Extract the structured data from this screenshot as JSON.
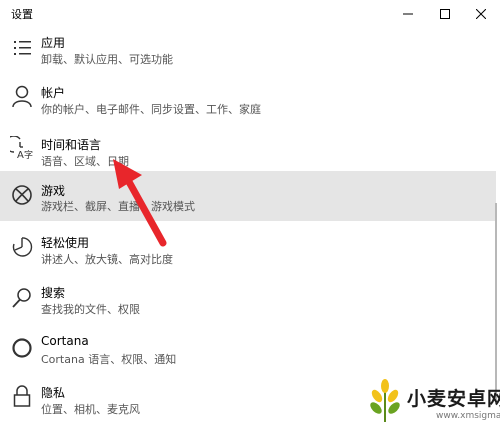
{
  "window": {
    "title": "设置",
    "minimize_label": "—",
    "maximize_label": "☐",
    "close_label": "✕"
  },
  "items": [
    {
      "name": "应用",
      "desc": "卸载、默认应用、可选功能",
      "icon": "apps-list-icon"
    },
    {
      "name": "帐户",
      "desc": "你的帐户、电子邮件、同步设置、工作、家庭",
      "icon": "person-icon"
    },
    {
      "name": "时间和语言",
      "desc": "语音、区域、日期",
      "icon": "time-language-icon"
    },
    {
      "name": "游戏",
      "desc": "游戏栏、截屏、直播、游戏模式",
      "icon": "xbox-icon",
      "selected": true
    },
    {
      "name": "轻松使用",
      "desc": "讲述人、放大镜、高对比度",
      "icon": "ease-of-access-icon"
    },
    {
      "name": "搜索",
      "desc": "查找我的文件、权限",
      "icon": "search-icon"
    },
    {
      "name": "Cortana",
      "desc": "Cortana 语言、权限、通知",
      "icon": "cortana-ring-icon"
    },
    {
      "name": "隐私",
      "desc": "位置、相机、麦克风",
      "icon": "lock-icon"
    }
  ],
  "colors": {
    "selected_bg": "#e5e5e5",
    "arrow": "#e8262b"
  },
  "watermark": {
    "text": "小麦安卓网",
    "url": "www.xmsigma.com"
  }
}
